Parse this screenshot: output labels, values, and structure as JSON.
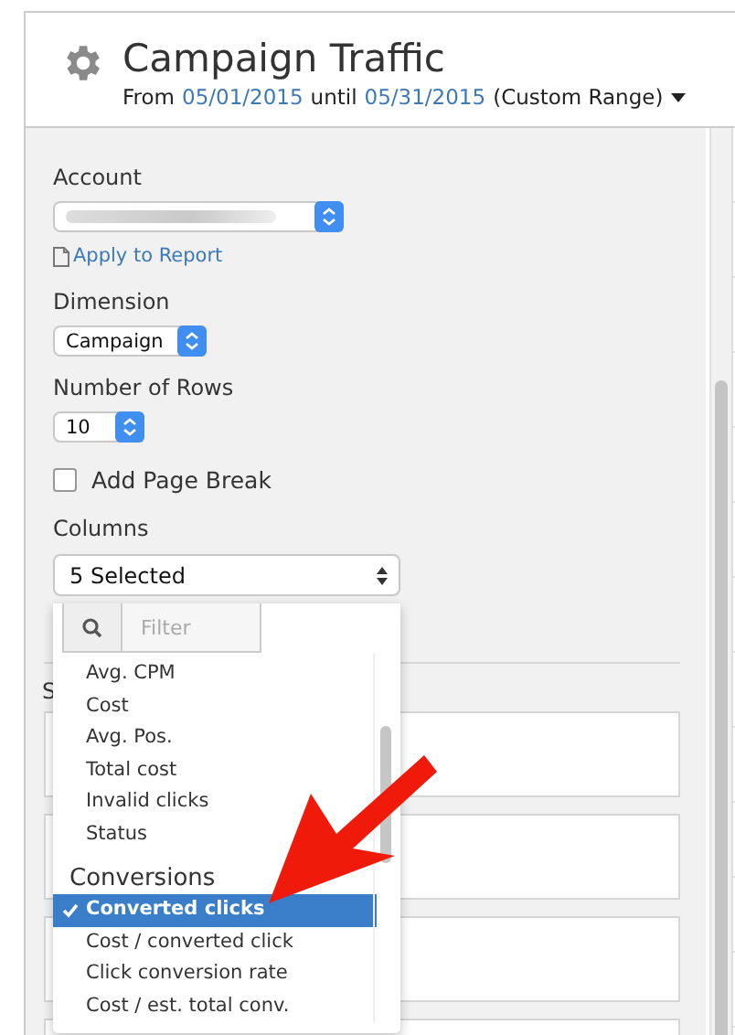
{
  "header": {
    "title": "Campaign Traffic",
    "range": {
      "prefix": "From",
      "start": "05/01/2015",
      "middle": "until",
      "end": "05/31/2015",
      "suffix": "(Custom Range)"
    }
  },
  "account": {
    "label": "Account",
    "apply_link": "Apply to Report"
  },
  "dimension": {
    "label": "Dimension",
    "value": "Campaign"
  },
  "rows": {
    "label": "Number of Rows",
    "value": "10"
  },
  "page_break": {
    "label": "Add Page Break",
    "checked": false
  },
  "columns": {
    "label": "Columns",
    "value": "5 Selected",
    "filter": {
      "placeholder": "Filter"
    },
    "items": [
      {
        "kind": "option",
        "label": "Avg. CPM",
        "selected": false
      },
      {
        "kind": "option",
        "label": "Cost",
        "selected": false
      },
      {
        "kind": "option",
        "label": "Avg. Pos.",
        "selected": false
      },
      {
        "kind": "option",
        "label": "Total cost",
        "selected": false
      },
      {
        "kind": "option",
        "label": "Invalid clicks",
        "selected": false
      },
      {
        "kind": "option",
        "label": "Status",
        "selected": false
      },
      {
        "kind": "heading",
        "label": "Conversions"
      },
      {
        "kind": "option",
        "label": "Converted clicks",
        "selected": true
      },
      {
        "kind": "option",
        "label": "Cost / converted click",
        "selected": false
      },
      {
        "kind": "option",
        "label": "Click conversion rate",
        "selected": false
      },
      {
        "kind": "option",
        "label": "Cost / est. total conv.",
        "selected": false
      }
    ]
  },
  "section_label": "S"
}
